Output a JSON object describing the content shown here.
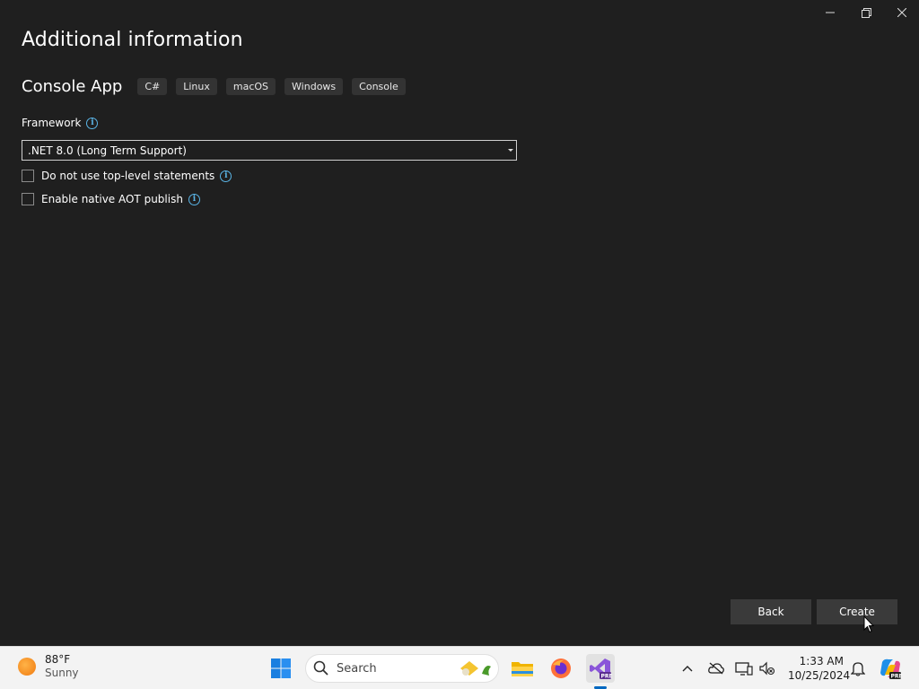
{
  "window": {
    "title": "Additional information",
    "template_name": "Console App",
    "tags": [
      "C#",
      "Linux",
      "macOS",
      "Windows",
      "Console"
    ],
    "framework": {
      "label": "Framework",
      "selected": ".NET 8.0 (Long Term Support)"
    },
    "options": {
      "top_level": "Do not use top-level statements",
      "aot": "Enable native AOT publish"
    },
    "buttons": {
      "back": "Back",
      "create": "Create"
    }
  },
  "taskbar": {
    "weather": {
      "temp": "88°F",
      "condition": "Sunny"
    },
    "search_label": "Search",
    "clock": {
      "time": "1:33 AM",
      "date": "10/25/2024"
    }
  },
  "colors": {
    "background": "#1f1f1f",
    "info_accent": "#5ab4e6",
    "button": "#3a3a3a",
    "taskbar": "#f3f3f3"
  }
}
